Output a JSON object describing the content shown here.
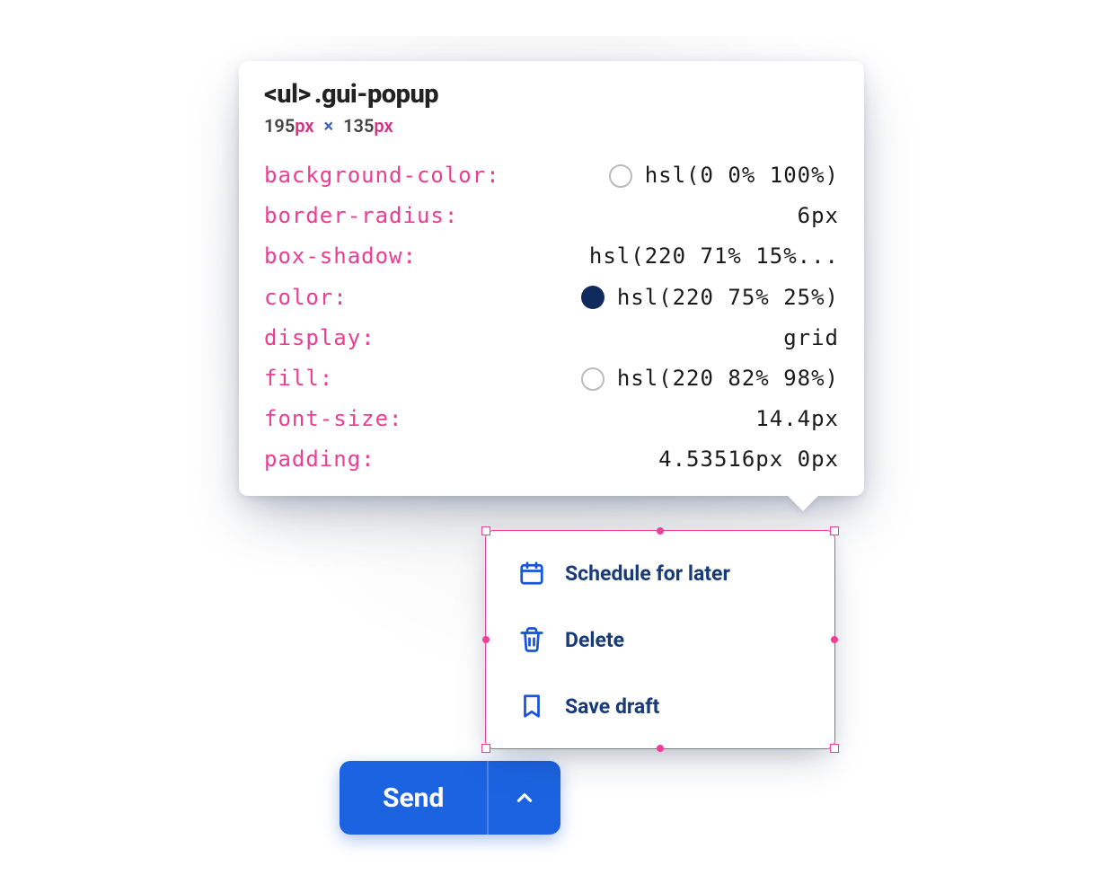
{
  "inspect": {
    "selector_tag": "<ul>",
    "selector_class": ".gui-popup",
    "width_num": "195",
    "height_num": "135",
    "px_unit": "px",
    "times": "×",
    "props": [
      {
        "key": "background-color",
        "value": "hsl(0 0% 100%)",
        "swatch": "#ffffff",
        "swatch_outline": true
      },
      {
        "key": "border-radius",
        "value": "6px"
      },
      {
        "key": "box-shadow",
        "value": "hsl(220 71% 15%..."
      },
      {
        "key": "color",
        "value": "hsl(220 75% 25%)",
        "swatch": "#102a5e",
        "swatch_outline": false
      },
      {
        "key": "display",
        "value": "grid"
      },
      {
        "key": "fill",
        "value": "hsl(220 82% 98%)",
        "swatch": "#f4f8fe",
        "swatch_outline": true
      },
      {
        "key": "font-size",
        "value": "14.4px"
      },
      {
        "key": "padding",
        "value": "4.53516px 0px"
      }
    ]
  },
  "popup": {
    "items": [
      {
        "icon": "calendar-icon",
        "label": "Schedule for later"
      },
      {
        "icon": "trash-icon",
        "label": "Delete"
      },
      {
        "icon": "bookmark-icon",
        "label": "Save draft"
      }
    ]
  },
  "send": {
    "label": "Send"
  }
}
